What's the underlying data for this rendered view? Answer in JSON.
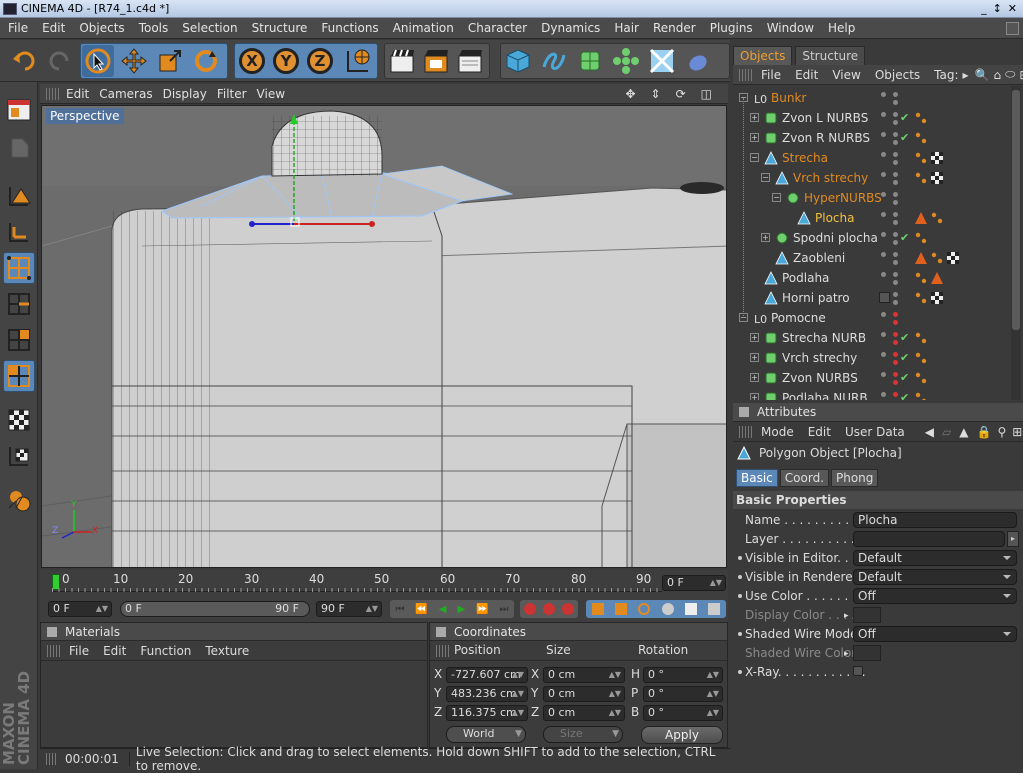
{
  "window": {
    "title": "CINEMA 4D - [R74_1.c4d *]",
    "controls": [
      "_",
      "↕",
      "✕"
    ]
  },
  "menubar": [
    "File",
    "Edit",
    "Objects",
    "Tools",
    "Selection",
    "Structure",
    "Functions",
    "Animation",
    "Character",
    "Dynamics",
    "Hair",
    "Render",
    "Plugins",
    "Window",
    "Help"
  ],
  "toolbar": {
    "axis_x": "X",
    "axis_y": "Y",
    "axis_z": "Z"
  },
  "viewport": {
    "menu": [
      "Edit",
      "Cameras",
      "Display",
      "Filter",
      "View"
    ],
    "label": "Perspective",
    "axis_labels": {
      "y": "Y",
      "z": "Z",
      "x": "X"
    }
  },
  "timeline": {
    "ticks": [
      "0",
      "10",
      "20",
      "30",
      "40",
      "50",
      "60",
      "70",
      "80",
      "90"
    ],
    "current_frame": "0 F",
    "start_field": "0 F",
    "range_start": "0 F",
    "range_end": "90 F",
    "end_field": "90 F"
  },
  "materials": {
    "title": "Materials",
    "menu": [
      "File",
      "Edit",
      "Function",
      "Texture"
    ]
  },
  "coordinates": {
    "title": "Coordinates",
    "headers": {
      "position": "Position",
      "size": "Size",
      "rotation": "Rotation"
    },
    "rows": [
      {
        "axis": "X",
        "pos": "-727.607 cm",
        "size_axis": "X",
        "size": "0 cm",
        "rot_axis": "H",
        "rot": "0 °"
      },
      {
        "axis": "Y",
        "pos": "483.236 cm",
        "size_axis": "Y",
        "size": "0 cm",
        "rot_axis": "P",
        "rot": "0 °"
      },
      {
        "axis": "Z",
        "pos": "116.375 cm",
        "size_axis": "Z",
        "size": "0 cm",
        "rot_axis": "B",
        "rot": "0 °"
      }
    ],
    "world_select": "World",
    "size_select": "Size",
    "apply": "Apply"
  },
  "status": {
    "time": "00:00:01",
    "message": "Live Selection: Click and drag to select elements. Hold down SHIFT to add to the selection, CTRL to remove."
  },
  "object_manager": {
    "tabs": [
      "Objects",
      "Structure"
    ],
    "menu": [
      "File",
      "Edit",
      "View",
      "Objects",
      "Tag:"
    ],
    "items": [
      {
        "name": "Bunkr",
        "depth": 0,
        "color": "or",
        "icon": "null-icon"
      },
      {
        "name": "Zvon  L NURBS",
        "depth": 1,
        "color": "",
        "icon": "nurbs-icon"
      },
      {
        "name": "Zvon  R NURBS",
        "depth": 1,
        "color": "",
        "icon": "nurbs-icon"
      },
      {
        "name": "Strecha",
        "depth": 1,
        "color": "or",
        "icon": "polygon-icon"
      },
      {
        "name": "Vrch strechy",
        "depth": 2,
        "color": "or",
        "icon": "polygon-icon"
      },
      {
        "name": "HyperNURBS",
        "depth": 3,
        "color": "or",
        "icon": "hypernurbs-icon"
      },
      {
        "name": "Plocha",
        "depth": 4,
        "color": "ye",
        "icon": "polygon-icon"
      },
      {
        "name": "Spodni plocha",
        "depth": 2,
        "color": "",
        "icon": "hypernurbs-icon"
      },
      {
        "name": "Zaobleni",
        "depth": 2,
        "color": "",
        "icon": "polygon-icon"
      },
      {
        "name": "Podlaha",
        "depth": 1,
        "color": "",
        "icon": "polygon-icon"
      },
      {
        "name": "Horni patro",
        "depth": 1,
        "color": "",
        "icon": "polygon-icon"
      },
      {
        "name": "Pomocne",
        "depth": 0,
        "color": "",
        "icon": "null-icon"
      },
      {
        "name": "Strecha NURB",
        "depth": 1,
        "color": "",
        "icon": "nurbs-icon"
      },
      {
        "name": "Vrch strechy",
        "depth": 1,
        "color": "",
        "icon": "nurbs-icon"
      },
      {
        "name": "Zvon NURBS",
        "depth": 1,
        "color": "",
        "icon": "nurbs-icon"
      },
      {
        "name": "Podlaha NURB",
        "depth": 1,
        "color": "",
        "icon": "nurbs-icon"
      }
    ]
  },
  "attributes": {
    "title": "Attributes",
    "menu": [
      "Mode",
      "Edit",
      "User Data"
    ],
    "object_title": "Polygon Object [Plocha]",
    "tabs": [
      "Basic",
      "Coord.",
      "Phong"
    ],
    "section": "Basic Properties",
    "fields": [
      {
        "label": "Name . . . . . . . . . . . .",
        "value": "Plocha",
        "type": "text",
        "dim": false,
        "bullet": false
      },
      {
        "label": "Layer . . . . . . . . . . . .",
        "value": "",
        "type": "layer",
        "dim": false,
        "bullet": false
      },
      {
        "label": "Visible in Editor. . . . .",
        "value": "Default",
        "type": "dd",
        "dim": false,
        "bullet": true
      },
      {
        "label": "Visible in Renderer . .",
        "value": "Default",
        "type": "dd",
        "dim": false,
        "bullet": true
      },
      {
        "label": "Use Color . . . . . . . . .",
        "value": "Off",
        "type": "dd",
        "dim": false,
        "bullet": true
      },
      {
        "label": "Display Color . . . .",
        "value": "",
        "type": "color",
        "dim": true,
        "bullet": false
      },
      {
        "label": "Shaded Wire Mode",
        "value": "Off",
        "type": "dd",
        "dim": false,
        "bullet": true
      },
      {
        "label": "Shaded Wire Color",
        "value": "",
        "type": "color",
        "dim": true,
        "bullet": false
      },
      {
        "label": "X-Ray. . . . . . . . . . . .",
        "value": "",
        "type": "check",
        "dim": false,
        "bullet": true
      }
    ]
  },
  "branding": {
    "text": "MAXON CINEMA 4D"
  },
  "colors": {
    "accent": "#e08a20",
    "selection": "#5b88b6",
    "highlight_name": "#f0c040"
  }
}
